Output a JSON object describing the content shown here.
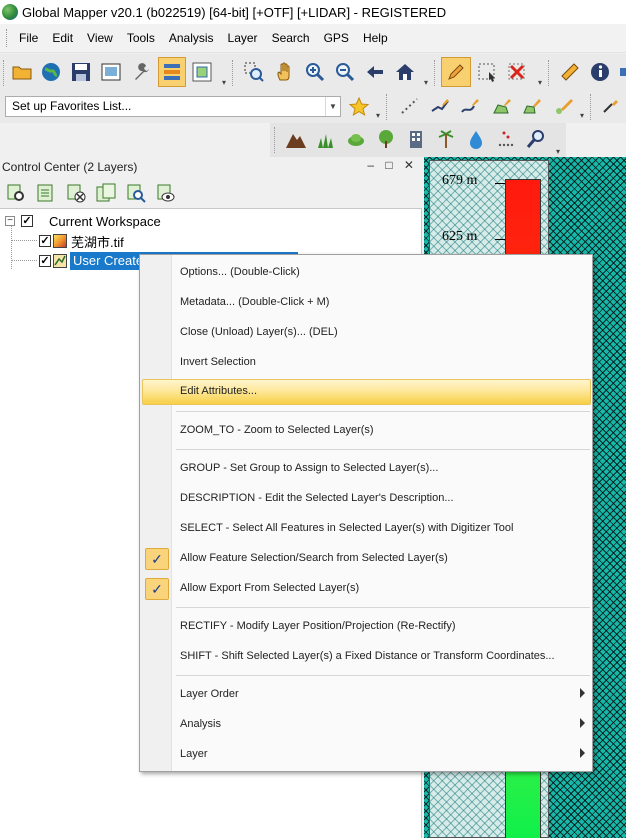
{
  "window": {
    "title": "Global Mapper v20.1 (b022519) [64-bit] [+OTF] [+LIDAR] - REGISTERED"
  },
  "menubar": [
    "File",
    "Edit",
    "View",
    "Tools",
    "Analysis",
    "Layer",
    "Search",
    "GPS",
    "Help"
  ],
  "toolbar": {
    "favorites_select_value": "Set up Favorites List..."
  },
  "control_center": {
    "title": "Control Center (2 Layers)",
    "window_controls": "– □ ✕",
    "tree": {
      "workspace_label": "Current Workspace",
      "layers": [
        {
          "label": "芜湖市.tif",
          "checked": true
        },
        {
          "label": "User Create",
          "checked": true,
          "selected": true
        }
      ]
    }
  },
  "map": {
    "legend_labels": [
      "679 m",
      "625 m"
    ]
  },
  "context_menu": {
    "items": [
      {
        "label": "Options... (Double-Click)"
      },
      {
        "label": "Metadata... (Double-Click + M)"
      },
      {
        "label": "Close (Unload) Layer(s)... (DEL)"
      },
      {
        "label": "Invert Selection"
      },
      {
        "label": "Edit Attributes...",
        "highlighted": true
      },
      {
        "label": "ZOOM_TO - Zoom to Selected Layer(s)"
      },
      {
        "label": "GROUP - Set Group to Assign to Selected Layer(s)..."
      },
      {
        "label": "DESCRIPTION - Edit the Selected Layer's Description..."
      },
      {
        "label": "SELECT - Select All Features in Selected Layer(s) with Digitizer Tool"
      },
      {
        "label": "Allow Feature Selection/Search from Selected Layer(s)",
        "checked": true
      },
      {
        "label": "Allow Export From Selected Layer(s)",
        "checked": true
      },
      {
        "label": "RECTIFY - Modify Layer Position/Projection (Re-Rectify)"
      },
      {
        "label": "SHIFT - Shift Selected Layer(s) a Fixed Distance or Transform Coordinates..."
      },
      {
        "label": "Layer Order",
        "submenu": true
      },
      {
        "label": "Analysis",
        "submenu": true
      },
      {
        "label": "Layer",
        "submenu": true
      }
    ],
    "check_glyph": "✓"
  },
  "colors": {
    "selection_blue": "#1979ca",
    "menu_highlight": "#f7cf46",
    "map_teal": "#17b7a9"
  }
}
